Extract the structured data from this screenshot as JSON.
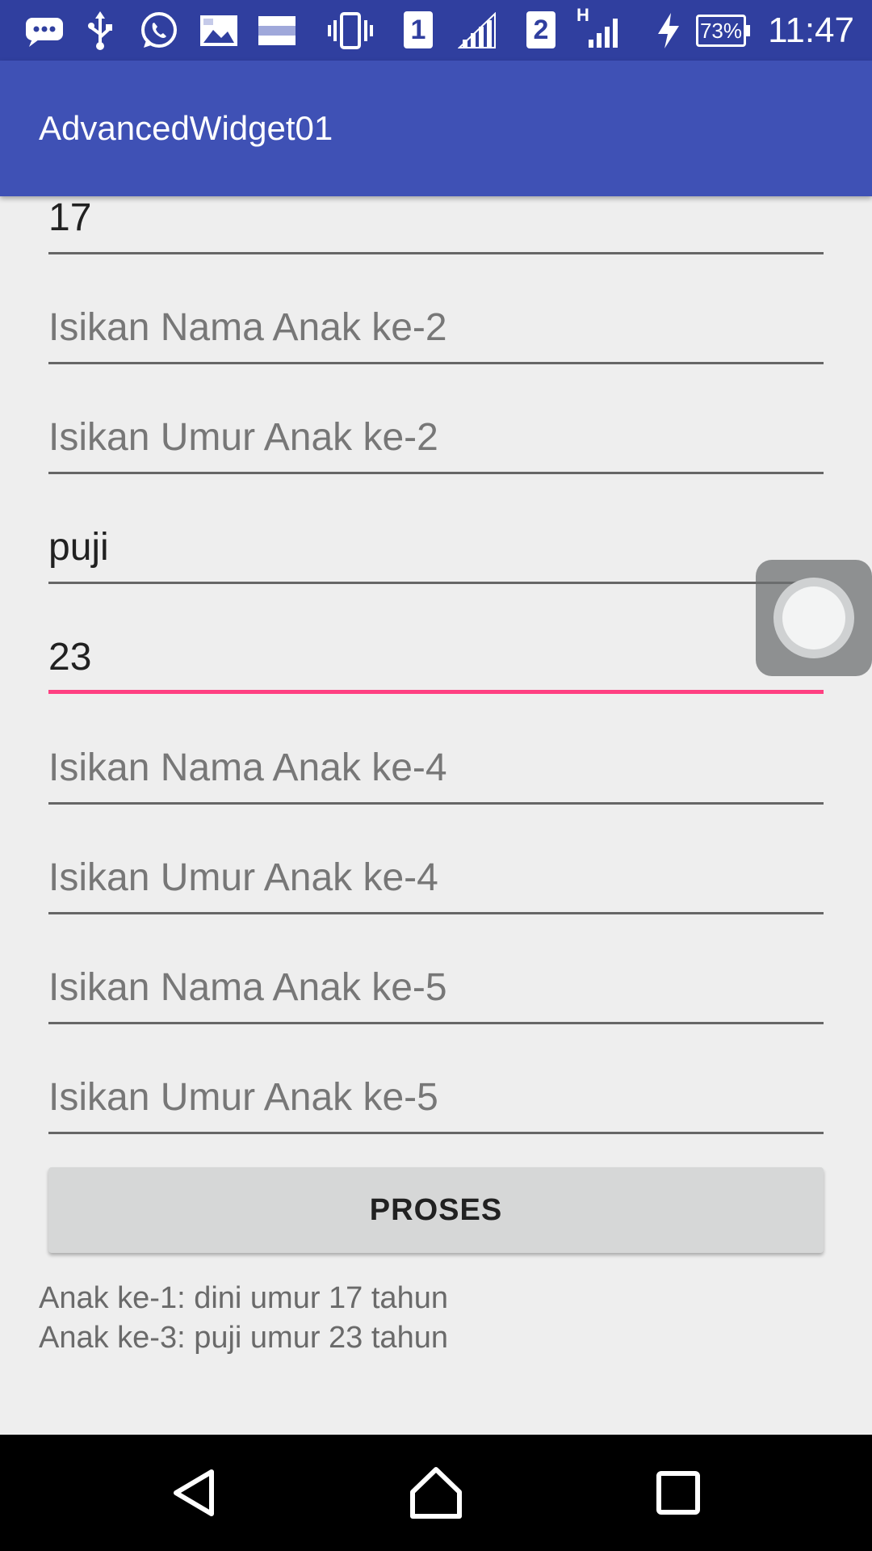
{
  "status_bar": {
    "time": "11:47",
    "battery": "73%",
    "sim1": "1",
    "sim2": "2",
    "network_type": "H",
    "icons": [
      "chat-icon",
      "usb-icon",
      "whatsapp-icon",
      "image-icon",
      "image-icon",
      "vibrate-icon",
      "signal-icon",
      "signal-icon",
      "charging-icon",
      "battery-icon"
    ]
  },
  "app_bar": {
    "title": "AdvancedWidget01"
  },
  "form": {
    "fields": [
      {
        "value": "17",
        "placeholder": ""
      },
      {
        "value": "",
        "placeholder": "Isikan Nama Anak ke-2"
      },
      {
        "value": "",
        "placeholder": "Isikan Umur Anak ke-2"
      },
      {
        "value": "puji",
        "placeholder": ""
      },
      {
        "value": "23",
        "placeholder": "",
        "focused": true
      },
      {
        "value": "",
        "placeholder": "Isikan Nama Anak ke-4"
      },
      {
        "value": "",
        "placeholder": "Isikan Umur Anak ke-4"
      },
      {
        "value": "",
        "placeholder": "Isikan Nama Anak ke-5"
      },
      {
        "value": "",
        "placeholder": "Isikan Umur Anak ke-5"
      }
    ],
    "process_button": "PROSES"
  },
  "result": {
    "lines": [
      "Anak ke-1: dini umur 17 tahun",
      "Anak ke-3: puji umur 23 tahun"
    ]
  },
  "colors": {
    "status_bar": "#303f9f",
    "app_bar": "#3f51b5",
    "accent": "#ff4081",
    "background": "#eeeeee"
  },
  "nav_bar": {
    "icons": [
      "back-icon",
      "home-icon",
      "recents-icon"
    ]
  }
}
